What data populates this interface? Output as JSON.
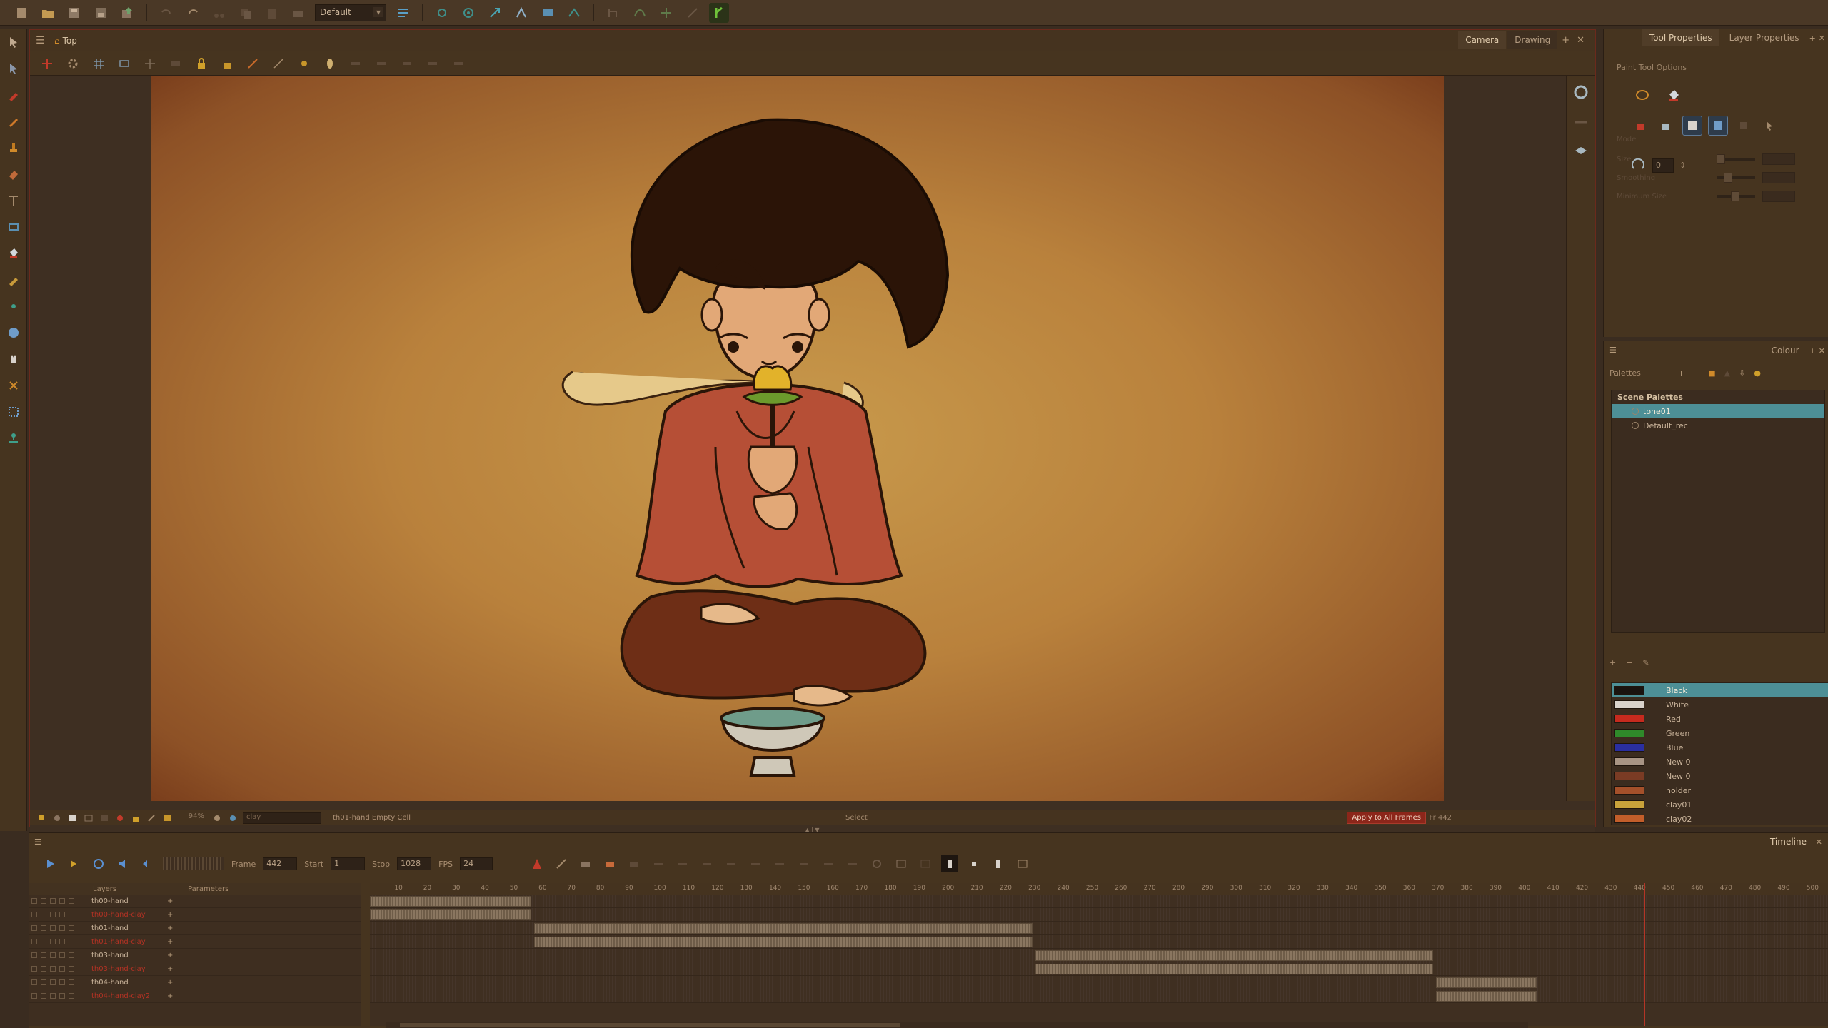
{
  "toolbar": {
    "workspace": "Default",
    "icons": [
      "new-icon",
      "open-icon",
      "save-icon",
      "save-all-icon",
      "import-icon",
      "undo-icon",
      "redo-icon",
      "cut-icon",
      "copy-icon",
      "paste-icon",
      "camera-icon",
      "workspace-icon",
      "transform-icon",
      "rotate-icon",
      "flip-icon",
      "morph-icon",
      "keyframe-icon",
      "node-icon",
      "branch-icon",
      "bezier-icon",
      "green-tool-icon"
    ]
  },
  "tools": [
    "select-arrow",
    "contour-editor",
    "brush",
    "pencil",
    "stamp",
    "eraser",
    "text",
    "shape",
    "paint-bucket",
    "dropper",
    "pivot",
    "hand-pan",
    "zoom",
    "transform",
    "cutter",
    "morph"
  ],
  "view": {
    "breadcrumb": "Top",
    "tabs": [
      "Camera",
      "Drawing"
    ],
    "active_tab": "Camera"
  },
  "status_bar": {
    "zoom": "94%",
    "frame_dropdown": "clay",
    "message": "th01-hand Empty Cell",
    "mode": "Select",
    "apply_label": "Apply to All Frames",
    "frame_readout": "Fr 442"
  },
  "tool_properties": {
    "tabs": [
      "Tool Properties",
      "Layer Properties"
    ],
    "active_tab": "Tool Properties",
    "section": "Paint Tool Options",
    "tolerance": "0",
    "rows": [
      "Mode",
      "Size",
      "Smoothing",
      "Minimum Size"
    ]
  },
  "colour": {
    "title": "Colour",
    "palettes_label": "Palettes",
    "scene_palettes_label": "Scene Palettes",
    "palettes": [
      {
        "name": "tohe01",
        "selected": true
      },
      {
        "name": "Default_rec",
        "selected": false
      }
    ],
    "swatches": [
      {
        "name": "Black",
        "color": "#1a1410",
        "selected": true
      },
      {
        "name": "White",
        "color": "#d8d2cb",
        "selected": false
      },
      {
        "name": "Red",
        "color": "#c62a1e",
        "selected": false
      },
      {
        "name": "Green",
        "color": "#2f8a2a",
        "selected": false
      },
      {
        "name": "Blue",
        "color": "#2a2fa0",
        "selected": false
      },
      {
        "name": "New 0",
        "color": "#a89484",
        "selected": false
      },
      {
        "name": "New 0",
        "color": "#7a3b24",
        "selected": false
      },
      {
        "name": "holder",
        "color": "#a4502a",
        "selected": false
      },
      {
        "name": "clay01",
        "color": "#c9a23a",
        "selected": false
      },
      {
        "name": "clay02",
        "color": "#c35e2a",
        "selected": false
      }
    ]
  },
  "timeline": {
    "title": "Timeline",
    "frame_label": "Frame",
    "frame": "442",
    "start_label": "Start",
    "start": "1",
    "stop_label": "Stop",
    "stop": "1028",
    "fps_label": "FPS",
    "fps": "24",
    "layers_label": "Layers",
    "parameters_label": "Parameters",
    "layers": [
      {
        "name": "th00-hand",
        "red": false
      },
      {
        "name": "th00-hand-clay",
        "red": true
      },
      {
        "name": "th01-hand",
        "red": false
      },
      {
        "name": "th01-hand-clay",
        "red": true
      },
      {
        "name": "th03-hand",
        "red": false
      },
      {
        "name": "th03-hand-clay",
        "red": true
      },
      {
        "name": "th04-hand",
        "red": false
      },
      {
        "name": "th04-hand-clay2",
        "red": true
      }
    ],
    "ruler": [
      "10",
      "20",
      "30",
      "40",
      "50",
      "60",
      "70",
      "80",
      "90",
      "100",
      "110",
      "120",
      "130",
      "140",
      "150",
      "160",
      "170",
      "180",
      "190",
      "200",
      "210",
      "220",
      "230",
      "240",
      "250",
      "260",
      "270",
      "280",
      "290",
      "300",
      "310",
      "320",
      "330",
      "340",
      "350",
      "360",
      "370",
      "380",
      "390",
      "400",
      "410",
      "420",
      "430",
      "440",
      "450",
      "460",
      "470",
      "480",
      "490",
      "500"
    ],
    "playhead_frame": 442,
    "visible_frames": 506
  }
}
